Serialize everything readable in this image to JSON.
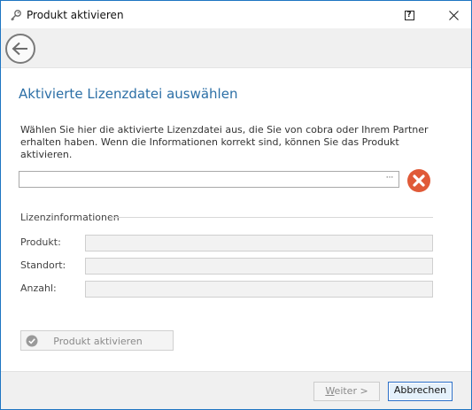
{
  "window": {
    "title": "Produkt aktivieren",
    "help_symbol": "?",
    "icons": {
      "title": "key-icon",
      "help": "help-icon",
      "close": "close-icon",
      "back": "back-arrow-icon"
    }
  },
  "page": {
    "heading": "Aktivierte Lizenzdatei auswählen",
    "description": "Wählen Sie hier die aktivierte Lizenzdatei aus, die Sie von cobra oder Ihrem Partner erhalten haben. Wenn die Informationen korrekt sind, können Sie das Produkt aktivieren."
  },
  "file_picker": {
    "value": "",
    "placeholder": "",
    "browse_label": "···",
    "clear_icon": "clear-error-icon",
    "clear_color": "#e05a38"
  },
  "license_info": {
    "group_label": "Lizenzinformationen",
    "fields": [
      {
        "label": "Produkt:",
        "value": ""
      },
      {
        "label": "Standort:",
        "value": ""
      },
      {
        "label": "Anzahl:",
        "value": ""
      }
    ]
  },
  "activate_button": {
    "label": "Produkt aktivieren",
    "icon": "check-circle-icon"
  },
  "footer": {
    "next_label_underlined": "W",
    "next_label_rest": "eiter >",
    "cancel_label": "Abbrechen"
  },
  "colors": {
    "accent": "#2c6fa6",
    "focus_border": "#2a6fc9"
  }
}
